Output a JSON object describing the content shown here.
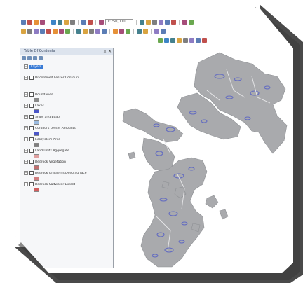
{
  "colors": {
    "land": "#a9aaad",
    "land_edge": "#8e9094",
    "water_detail": "#4b56c8",
    "toc_bg": "#f6f7f9",
    "selection": "#3a7bd5"
  },
  "toolbar": {
    "rows": [
      [
        "new-icon",
        "open-icon",
        "save-icon",
        "print-icon",
        "sep",
        "cut-icon",
        "copy-icon",
        "paste-icon",
        "delete-icon",
        "sep",
        "undo-icon",
        "redo-icon",
        "sep",
        "add-data-icon",
        "scale-combo",
        "sep",
        "editor-icon",
        "table-icon",
        "catalog-icon",
        "search-icon",
        "toolbox-icon",
        "python-icon",
        "sep",
        "model-icon",
        "help-icon"
      ],
      [
        "zoom-in-icon",
        "zoom-out-icon",
        "pan-icon",
        "full-extent-icon",
        "fixed-zoom-in-icon",
        "fixed-zoom-out-icon",
        "back-icon",
        "forward-icon",
        "sep",
        "select-icon",
        "clear-selection-icon",
        "identify-icon",
        "find-icon",
        "measure-icon",
        "sep",
        "hyperlink-icon",
        "html-popup-icon",
        "go-to-xy-icon",
        "sep",
        "time-slider-icon",
        "create-viewer-icon",
        "sep",
        "draw-icon",
        "text-icon"
      ],
      [
        "snap-icon",
        "trace-icon",
        "edit-vertices-icon",
        "reshape-icon",
        "cut-polygons-icon",
        "rotate-icon",
        "attributes-icon",
        "sketch-props-icon"
      ]
    ],
    "scale_value": "1:250,000"
  },
  "toc": {
    "title": "Table Of Contents",
    "layers": [
      {
        "label": "Layers",
        "selected": true,
        "swatch": ""
      },
      {
        "label": "Unconfined Lesser Contours",
        "selected": false,
        "swatch": ""
      },
      {
        "label": "Boundaries",
        "selected": false,
        "swatch": "#8a8a8a"
      },
      {
        "label": "Lakes",
        "selected": false,
        "swatch": "#4b56c8"
      },
      {
        "label": "Ships and Boats",
        "selected": false,
        "swatch": "#9bbbe0"
      },
      {
        "label": "Contours Lesser Amounts",
        "selected": false,
        "swatch": "#4b56c8"
      },
      {
        "label": "Ecosystem Area",
        "selected": false,
        "swatch": "#7f7f7f"
      },
      {
        "label": "Land Units Aggregate",
        "selected": false,
        "swatch": "#e0a0a0"
      },
      {
        "label": "Bedrock Vegetation",
        "selected": false,
        "swatch": "#c07070"
      },
      {
        "label": "Bedrock Gradients Deep Surface",
        "selected": false,
        "swatch": "#d08080"
      },
      {
        "label": "Bedrock Saltwater Extent",
        "selected": false,
        "swatch": "#d06060"
      }
    ]
  }
}
